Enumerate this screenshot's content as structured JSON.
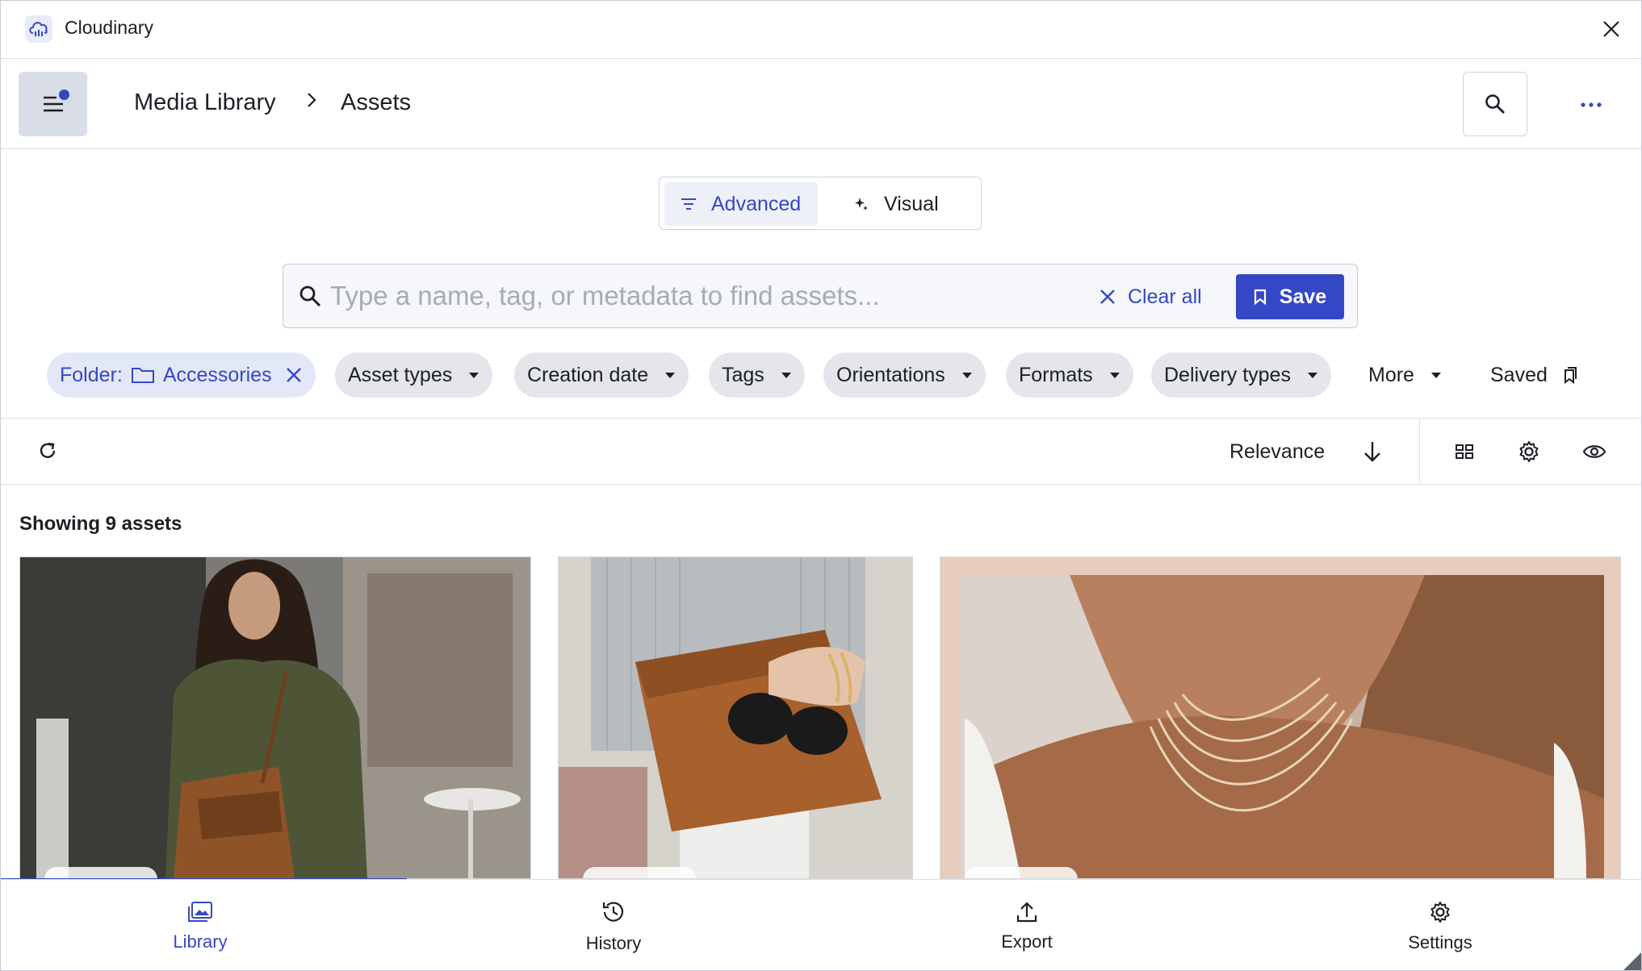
{
  "app": {
    "title": "Cloudinary"
  },
  "breadcrumb": {
    "root": "Media Library",
    "current": "Assets"
  },
  "search_mode": {
    "advanced_label": "Advanced",
    "visual_label": "Visual",
    "selected": "Advanced"
  },
  "search": {
    "placeholder": "Type a name, tag, or metadata to find assets...",
    "value": "",
    "clear_label": "Clear all",
    "save_label": "Save"
  },
  "filters": {
    "folder_prefix": "Folder:",
    "folder_name": "Accessories",
    "chips": [
      "Asset types",
      "Creation date",
      "Tags",
      "Orientations",
      "Formats",
      "Delivery types"
    ],
    "more_label": "More",
    "saved_label": "Saved"
  },
  "toolbar": {
    "sort_label": "Relevance"
  },
  "results": {
    "showing": "Showing 9 assets"
  },
  "bottom_nav": {
    "library": "Library",
    "history": "History",
    "export": "Export",
    "settings": "Settings",
    "active": "Library"
  },
  "colors": {
    "accent": "#3448c5",
    "chip_bg": "#e4e6eb",
    "folder_chip_bg": "#e3e8f8"
  },
  "icons": [
    "cloud-logo-icon",
    "close-icon",
    "menu-icon",
    "chevron-right-icon",
    "search-icon",
    "more-icon",
    "filter-icon",
    "sparkle-icon",
    "bookmark-icon",
    "folder-icon",
    "caret-down-icon",
    "refresh-icon",
    "arrow-down-icon",
    "grid-icon",
    "gear-icon",
    "eye-icon",
    "library-icon",
    "history-icon",
    "export-icon"
  ],
  "images": [
    {
      "name": "woman-with-leather-bag"
    },
    {
      "name": "leather-clutch-with-sunglasses"
    },
    {
      "name": "layered-necklaces"
    }
  ]
}
